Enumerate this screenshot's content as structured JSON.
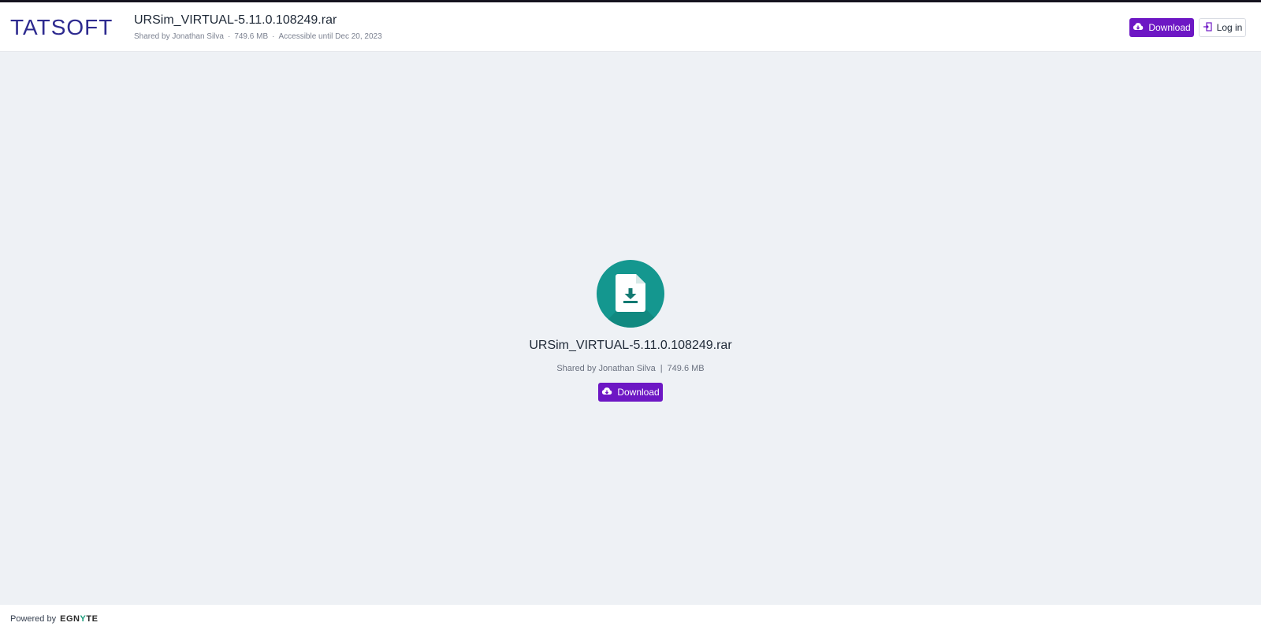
{
  "header": {
    "logo_text": "TATSOFT",
    "file_title": "URSim_VIRTUAL-5.11.0.108249.rar",
    "shared_by": "Shared by Jonathan Silva",
    "size": "749.6 MB",
    "accessible": "Accessible until Dec 20, 2023",
    "meta_separator": "·",
    "download_label": "Download",
    "login_label": "Log in"
  },
  "main": {
    "file_icon": "file-download-icon",
    "file_name": "URSim_VIRTUAL-5.11.0.108249.rar",
    "shared_by": "Shared by Jonathan Silva",
    "separator": "|",
    "size": "749.6 MB",
    "download_label": "Download"
  },
  "footer": {
    "powered_by": "Powered by",
    "brand_left": "EGN",
    "brand_mid": "Y",
    "brand_right": "TE"
  },
  "colors": {
    "accent": "#6d17c4",
    "file_icon_bg": "#14978f",
    "logo": "#2d2a8f"
  }
}
